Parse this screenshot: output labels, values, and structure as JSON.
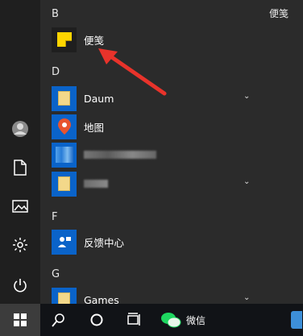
{
  "header": {
    "top_right_label": "便笺"
  },
  "sections": [
    {
      "letter": "B",
      "apps": [
        {
          "name": "便笺",
          "icon": "sticky-notes-icon",
          "accent": "#ffd500"
        }
      ]
    },
    {
      "letter": "D",
      "apps": [
        {
          "name": "Daum",
          "icon": "folder-icon",
          "expand": true
        },
        {
          "name": "地图",
          "icon": "maps-pin-icon",
          "accent": "#e8542e"
        },
        {
          "name": "",
          "icon": "blurred-app-icon"
        },
        {
          "name": "",
          "icon": "folder-icon",
          "expand": true
        }
      ]
    },
    {
      "letter": "F",
      "apps": [
        {
          "name": "反馈中心",
          "icon": "feedback-hub-icon"
        }
      ]
    },
    {
      "letter": "G",
      "apps": [
        {
          "name": "Games",
          "icon": "folder-icon",
          "expand": true
        }
      ]
    }
  ],
  "taskbar": {
    "wechat_label": "微信"
  },
  "colors": {
    "tile_blue": "#0a63c9",
    "arrow_red": "#e8332b"
  }
}
